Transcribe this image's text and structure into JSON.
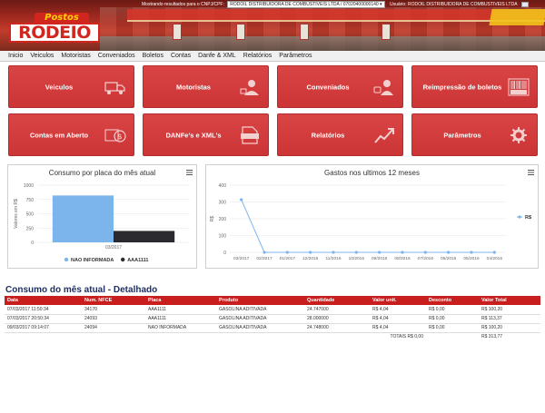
{
  "header": {
    "logo_top": "Postos",
    "logo_main": "RODEIO",
    "result_label": "Mostrando resultados para o CNPJ/CPF:",
    "cnpj_value": "RODOIL DISTRIBUIDORA DE COMBUSTIVEIS LTDA / 07020400000140",
    "user_label": "Usuário: RODOIL DISTRIBUIDORA DE COMBUSTIVEIS LTDA"
  },
  "nav": [
    "Inicio",
    "Veiculos",
    "Motoristas",
    "Conveniados",
    "Boletos",
    "Contas",
    "Danfe & XML",
    "Relatórios",
    "Parâmetros"
  ],
  "tiles": [
    {
      "label": "Veiculos",
      "icon": "truck-icon"
    },
    {
      "label": "Motoristas",
      "icon": "driver-icon"
    },
    {
      "label": "Conveniados",
      "icon": "partner-icon"
    },
    {
      "label": "Reimpressão de boletos",
      "icon": "barcode-icon"
    },
    {
      "label": "Contas em Aberto",
      "icon": "money-icon"
    },
    {
      "label": "DANFe's e XML's",
      "icon": "xml-file-icon"
    },
    {
      "label": "Relatórios",
      "icon": "chart-up-icon"
    },
    {
      "label": "Parâmetros",
      "icon": "gear-icon"
    }
  ],
  "chart_data": [
    {
      "type": "bar",
      "title": "Consumo por placa do mês atual",
      "ylabel": "Valores em R$",
      "ylim": [
        0,
        1000
      ],
      "yticks": [
        "1000",
        "750",
        "500",
        "250",
        "0"
      ],
      "categories": [
        "03/2017"
      ],
      "series": [
        {
          "name": "NAO INFORMADA",
          "color": "#7cb5ec",
          "values": [
            820
          ]
        },
        {
          "name": "AAA1111",
          "color": "#2b2b2f",
          "values": [
            200
          ]
        }
      ],
      "legend": "bottom"
    },
    {
      "type": "line",
      "title": "Gastos nos ultimos 12 meses",
      "ylabel": "R$",
      "ylim": [
        0,
        400
      ],
      "yticks": [
        "400",
        "300",
        "200",
        "100",
        "0"
      ],
      "categories": [
        "03/2017",
        "02/2017",
        "01/2017",
        "12/2016",
        "11/2016",
        "10/2016",
        "09/2016",
        "08/2016",
        "07/2016",
        "06/2016",
        "05/2016",
        "04/2016"
      ],
      "series": [
        {
          "name": "R$",
          "color": "#7cb5ec",
          "values": [
            313.77,
            0,
            0,
            0,
            0,
            0,
            0,
            0,
            0,
            0,
            0,
            0
          ]
        }
      ],
      "legend": "right"
    }
  ],
  "table": {
    "title": "Consumo do mês atual - Detalhado",
    "columns": [
      "Data",
      "Num. NFCE",
      "Placa",
      "Produto",
      "Quantidade",
      "Valor unit.",
      "Desconto",
      "Valor Total"
    ],
    "rows": [
      [
        "07/03/2017 11:50:34",
        "34170",
        "AAA1111",
        "GASOLINA ADITIVADA",
        "24.747000",
        "R$ 4,04",
        "R$ 0,00",
        "R$ 100,20"
      ],
      [
        "07/03/2017 20:50:34",
        "24093",
        "AAA1111",
        "GASOLINA ADITIVADA",
        "28.000000",
        "R$ 4,04",
        "R$ 0,00",
        "R$ 113,37"
      ],
      [
        "09/03/2017 09:14:07",
        "24094",
        "NAO INFORMADA",
        "GASOLINA ADITIVADA",
        "24.748000",
        "R$ 4,04",
        "R$ 0,00",
        "R$ 100,20"
      ]
    ],
    "totals_label": "TOTAIS R$ 0,00",
    "totals_value": "R$ 313,77"
  },
  "colors": {
    "accent": "#d0393a",
    "header_red": "#c81e1e",
    "navy": "#1d2d5f"
  }
}
